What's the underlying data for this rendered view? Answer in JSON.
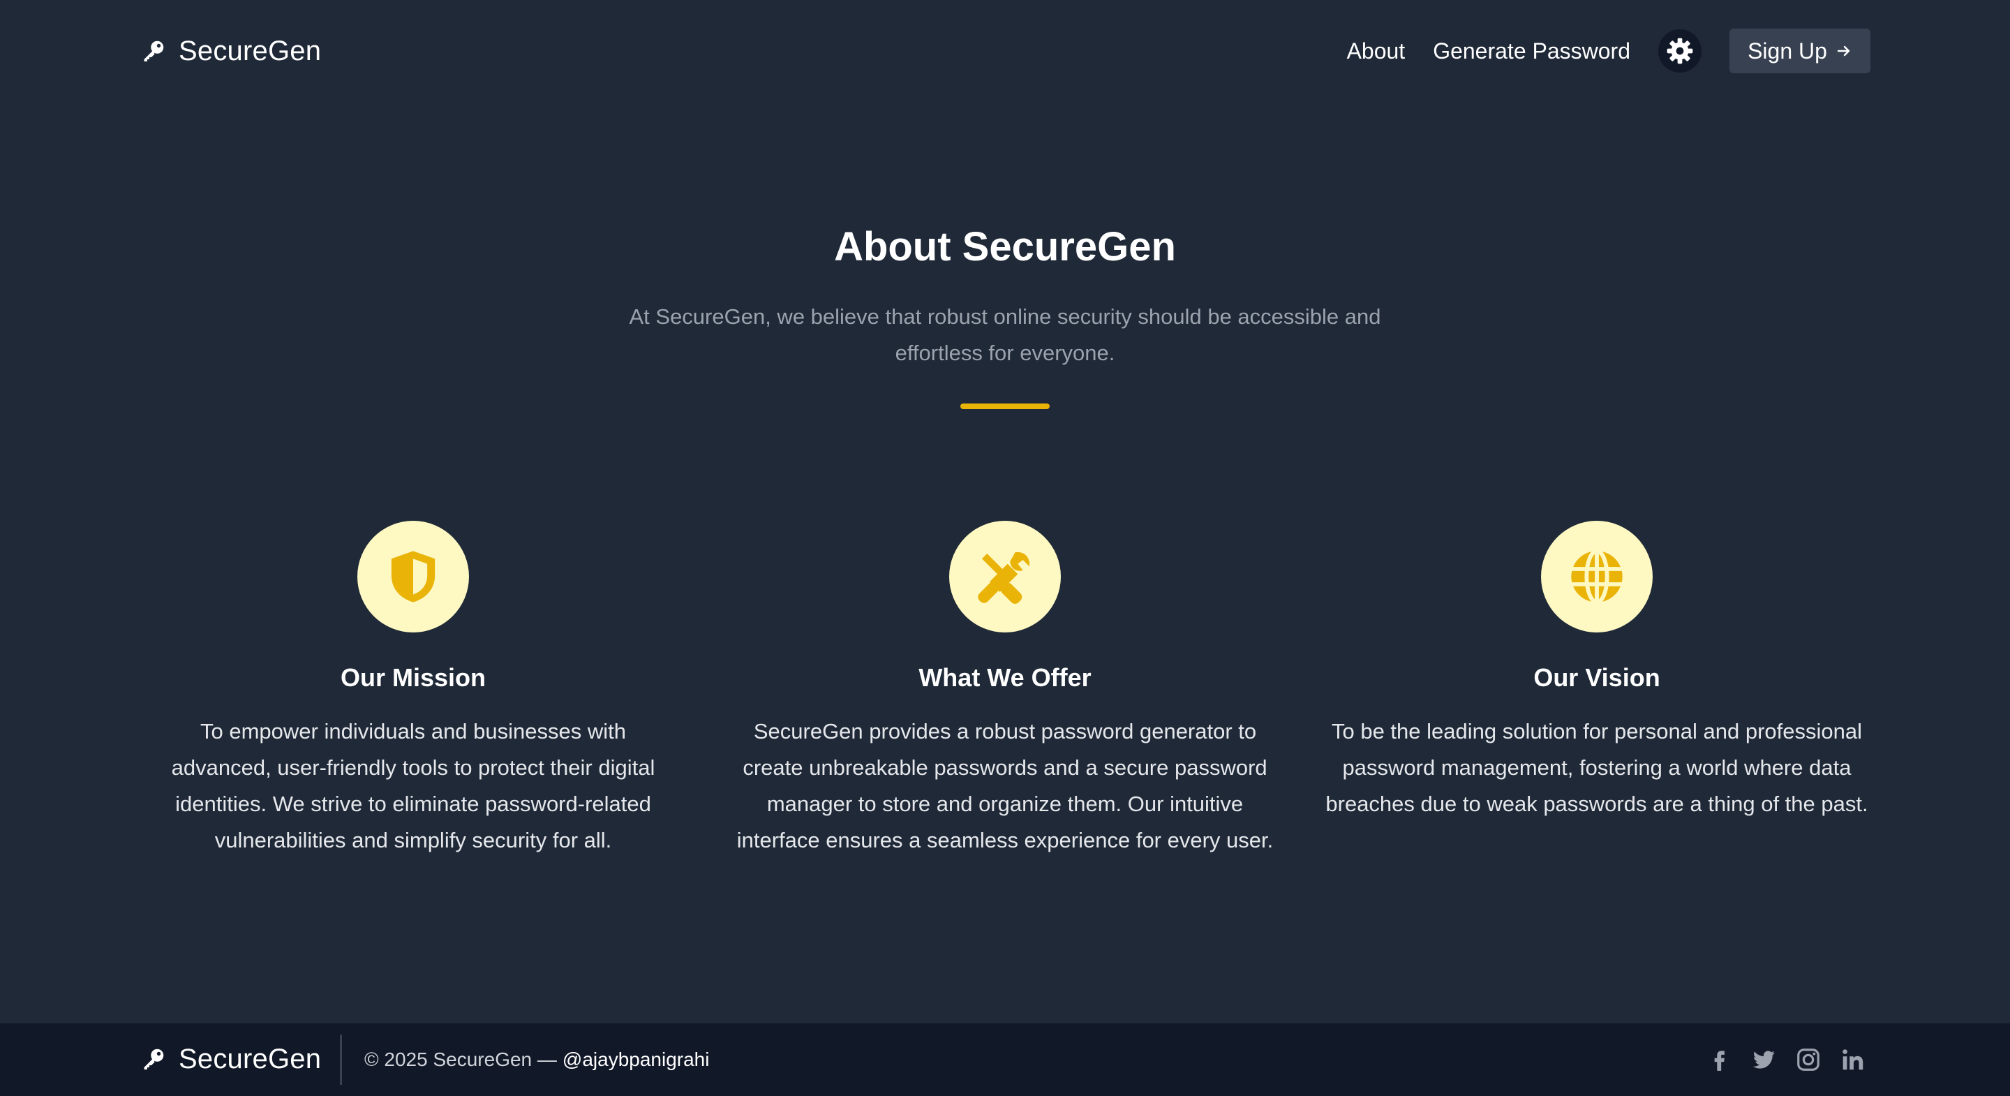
{
  "brand": {
    "name": "SecureGen",
    "icon": "key-icon"
  },
  "nav": {
    "links": [
      "About",
      "Generate Password"
    ],
    "theme_toggle_icon": "gear-icon",
    "signup_label": "Sign Up",
    "signup_icon": "arrow-right-icon"
  },
  "hero": {
    "title": "About SecureGen",
    "subtitle": "At SecureGen, we believe that robust online security should be accessible and effortless for everyone."
  },
  "features": [
    {
      "icon": "shield-icon",
      "title": "Our Mission",
      "text": "To empower individuals and businesses with advanced, user-friendly tools to protect their digital identities. We strive to eliminate password-related vulnerabilities and simplify security for all."
    },
    {
      "icon": "tools-icon",
      "title": "What We Offer",
      "text": "SecureGen provides a robust password generator to create unbreakable passwords and a secure password manager to store and organize them. Our intuitive interface ensures a seamless experience for every user."
    },
    {
      "icon": "globe-icon",
      "title": "Our Vision",
      "text": "To be the leading solution for personal and professional password management, fostering a world where data breaches due to weak passwords are a thing of the past."
    }
  ],
  "footer": {
    "brand": "SecureGen",
    "copyright": "© 2025 SecureGen —",
    "handle": "@ajaybpanigrahi",
    "social_icons": [
      "facebook-icon",
      "twitter-icon",
      "instagram-icon",
      "linkedin-icon"
    ]
  },
  "colors": {
    "background": "#1f2937",
    "footer_background": "#111827",
    "accent": "#eab308",
    "icon_circle": "#fef9c3",
    "button": "#374151"
  }
}
